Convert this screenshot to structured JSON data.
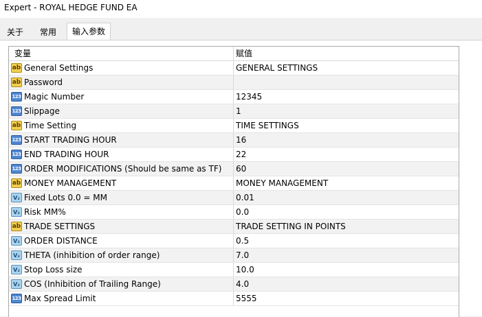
{
  "window": {
    "title": "Expert - ROYAL HEDGE FUND EA"
  },
  "tabs": [
    {
      "label": "关于"
    },
    {
      "label": "常用"
    },
    {
      "label": "输入参数"
    }
  ],
  "grid": {
    "headers": {
      "variable": "变量",
      "value": "赋值"
    },
    "icon_labels": {
      "ab": "ab",
      "n123": "123",
      "frac": "V₂"
    },
    "rows": [
      {
        "icon": "string-type-icon",
        "name": "General Settings",
        "value": "GENERAL SETTINGS"
      },
      {
        "icon": "string-type-icon",
        "name": "Password",
        "value": ""
      },
      {
        "icon": "integer-type-icon",
        "name": "Magic Number",
        "value": "12345"
      },
      {
        "icon": "integer-type-icon",
        "name": "Slippage",
        "value": "1"
      },
      {
        "icon": "string-type-icon",
        "name": "Time Setting",
        "value": "TIME SETTINGS"
      },
      {
        "icon": "integer-type-icon",
        "name": "START TRADING HOUR",
        "value": "16"
      },
      {
        "icon": "integer-type-icon",
        "name": "END TRADING HOUR",
        "value": "22"
      },
      {
        "icon": "integer-type-icon",
        "name": "ORDER MODIFICATIONS (Should be same as TF)",
        "value": "60"
      },
      {
        "icon": "string-type-icon",
        "name": "MONEY MANAGEMENT",
        "value": "MONEY MANAGEMENT"
      },
      {
        "icon": "double-type-icon",
        "name": "Fixed Lots 0.0 = MM",
        "value": "0.01"
      },
      {
        "icon": "double-type-icon",
        "name": "Risk MM%",
        "value": "0.0"
      },
      {
        "icon": "string-type-icon",
        "name": "TRADE SETTINGS",
        "value": "TRADE SETTING IN POINTS"
      },
      {
        "icon": "double-type-icon",
        "name": "ORDER DISTANCE",
        "value": "0.5"
      },
      {
        "icon": "double-type-icon",
        "name": "THETA (inhibition of order range)",
        "value": "7.0"
      },
      {
        "icon": "double-type-icon",
        "name": "Stop Loss size",
        "value": "10.0"
      },
      {
        "icon": "double-type-icon",
        "name": "COS (Inhibition of Trailing Range)",
        "value": "4.0"
      },
      {
        "icon": "integer-type-icon",
        "name": "Max Spread Limit",
        "value": "5555"
      }
    ]
  }
}
